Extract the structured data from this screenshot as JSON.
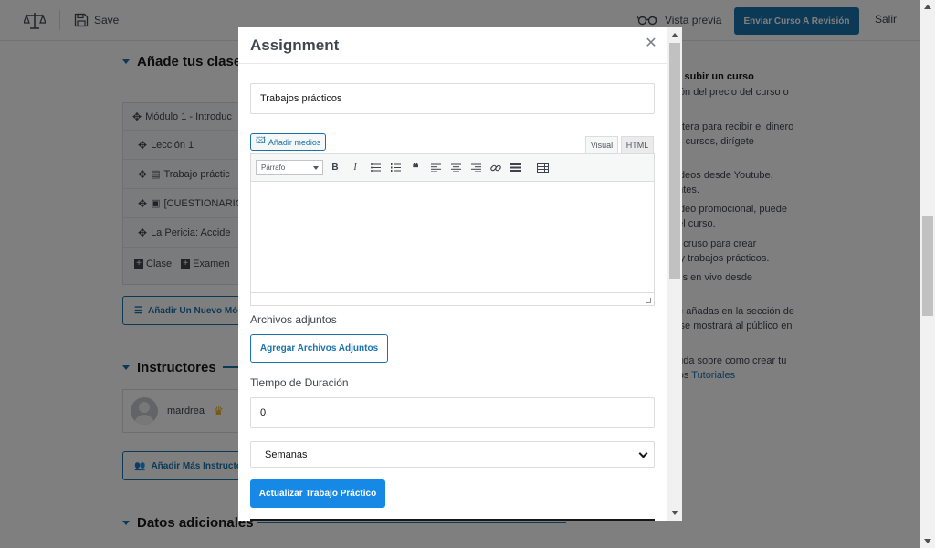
{
  "topbar": {
    "save_label": "Save",
    "preview_label": "Vista previa",
    "submit_label": "Enviar Curso A Revisión",
    "exit_label": "Salir"
  },
  "background": {
    "section_classes": "Añade tus clases",
    "topic_title": "Módulo 1 - Introduc",
    "topic_items": [
      "Lección 1",
      "Trabajo práctic",
      "[CUESTIONARIO",
      "La Pericia: Accide"
    ],
    "add_class_label": "Clase",
    "add_exam_label": "Examen",
    "add_module_button": "Añadir Un Nuevo Módu",
    "section_instructors": "Instructores",
    "instructor_name": "mardrea",
    "add_instructors_button": "Añadir Más Instructor",
    "section_additional": "Datos adicionales",
    "tips": [
      {
        "text": "ra subir un curso",
        "bold": true
      },
      {
        "text": "ción del precio del curso o"
      },
      {
        "text": "lletera para recibir el dinero"
      },
      {
        "text": "us cursos, dirígete"
      },
      {
        "text": "videos desde Youtube,"
      },
      {
        "text": "entes."
      },
      {
        "text": "video promocional, puede"
      },
      {
        "text": "del curso."
      },
      {
        "text": "tu cruso para crear"
      },
      {
        "text": "s y trabajos prácticos."
      },
      {
        "text": "ses en vivo desde"
      },
      {
        "text": "ue añadas en la sección de"
      },
      {
        "text": "s se mostrará al público en"
      },
      {
        "text": "duda sobre como crear tu"
      },
      {
        "text": "tros ",
        "link": "Tutoriales"
      }
    ]
  },
  "modal": {
    "title": "Assignment",
    "title_value": "Trabajos prácticos",
    "add_media_label": "Añadir medios",
    "tab_visual": "Visual",
    "tab_html": "HTML",
    "format_select": "Párrafo",
    "attachments_label": "Archivos adjuntos",
    "attach_button": "Agregar Archivos Adjuntos",
    "duration_label": "Tiempo de Duración",
    "duration_value": "0",
    "duration_unit": "Semanas",
    "update_button": "Actualizar Trabajo Práctico"
  },
  "colors": {
    "primary": "#1973aa",
    "update_button": "#1689e6",
    "overlay": "rgba(0,0,0,0.5)"
  },
  "icons": [
    "scale-icon",
    "save-icon",
    "glasses-icon",
    "move-icon",
    "clipboard-icon",
    "quiz-icon",
    "plus-square-icon",
    "crown-icon",
    "close-icon",
    "media-icon",
    "bold-icon",
    "italic-icon",
    "bullet-list-icon",
    "numbered-list-icon",
    "blockquote-icon",
    "align-left-icon",
    "align-center-icon",
    "align-right-icon",
    "link-icon",
    "read-more-icon",
    "toolbar-toggle-icon"
  ]
}
